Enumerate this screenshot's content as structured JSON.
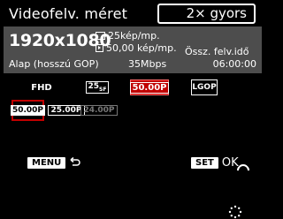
{
  "title": "Videofelv. méret",
  "selected_value": "2× gyors",
  "info": {
    "resolution": "1920x1080",
    "fps_primary": "25kép/mp.",
    "fps_secondary": "50,00 kép/mp.",
    "total_label": "Össz. felv.idő",
    "compression": "Alap (hosszú GOP)",
    "bitrate": "35Mbps",
    "time": "06:00:00"
  },
  "options": {
    "fhd": "FHD",
    "fps25": "25",
    "fps25_sub": "SF",
    "selected": "50.00P",
    "lgop": "LGOP"
  },
  "sub_options": {
    "a": "50.00P",
    "b": "25.00P",
    "c": "24.00P"
  },
  "buttons": {
    "menu": "MENU",
    "set": "SET",
    "ok": "OK"
  },
  "colors": {
    "accent": "#c00000",
    "panel": "#4d4d4d",
    "background": "#000000"
  },
  "icons": [
    "film-icon",
    "frame-icon",
    "arc-icon",
    "dial-icon",
    "back-arrow-icon"
  ]
}
